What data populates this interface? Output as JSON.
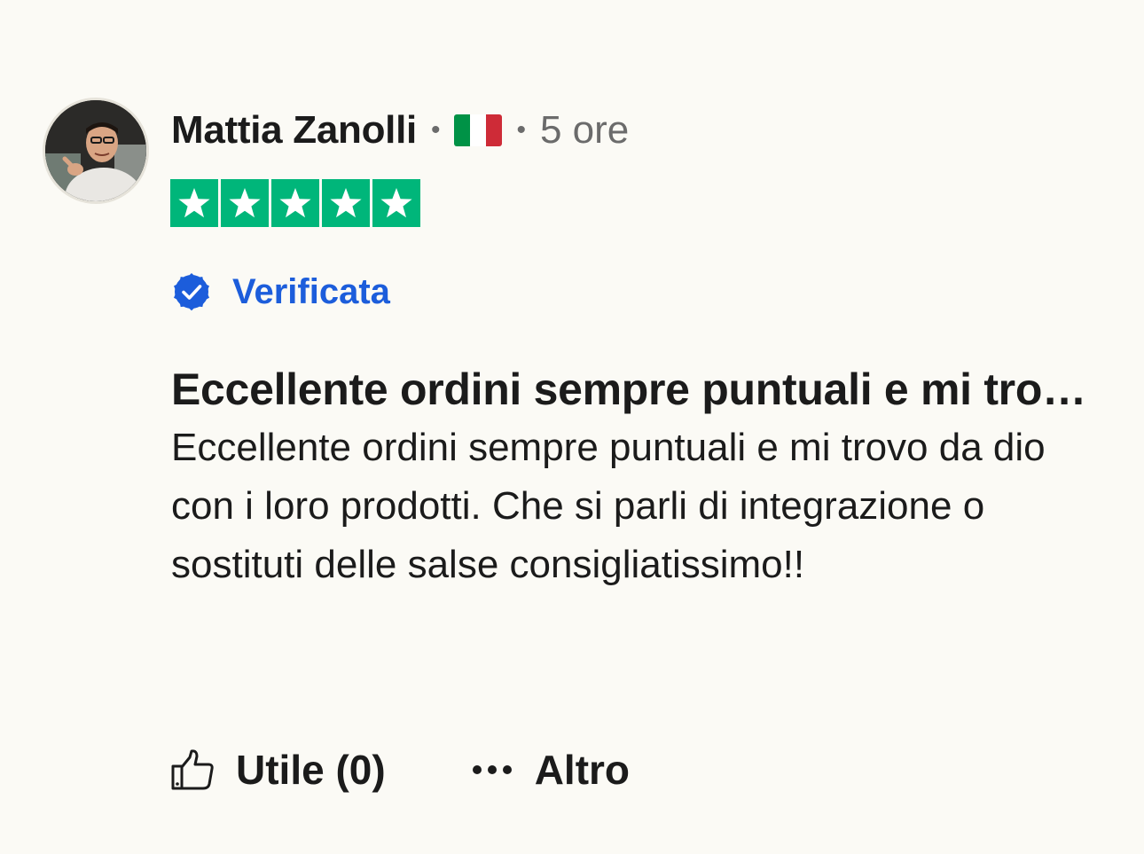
{
  "review": {
    "author": "Mattia Zanolli",
    "separator": "•",
    "country": "Italia",
    "flag_colors": [
      "#009246",
      "#ffffff",
      "#ce2b37"
    ],
    "time_ago": "5 ore",
    "rating": 5,
    "rating_max": 5,
    "star_color": "#00b67a",
    "verified_label": "Verificata",
    "verified_color": "#1c5ddb",
    "title": "Eccellente ordini sempre puntuali e mi trovo da dio con i loro prodotti",
    "body": "Eccellente ordini sempre puntuali e mi trovo da dio con i loro prodotti. Che si parli di integrazione o sostituti delle salse consigliatissimo!!"
  },
  "actions": {
    "useful_label": "Utile (0)",
    "useful_icon": "thumbs-up-icon",
    "more_label": "Altro",
    "more_icon": "more-dots-icon"
  }
}
